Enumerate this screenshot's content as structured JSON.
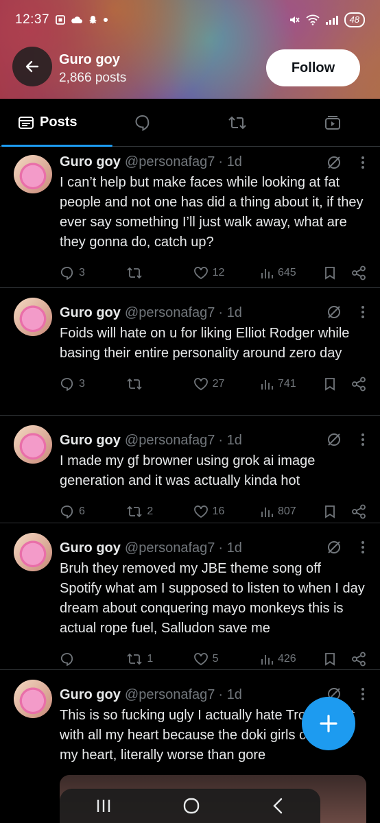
{
  "status_bar": {
    "time": "12:37",
    "battery": "48"
  },
  "header": {
    "name": "Guro goy",
    "posts_count": "2,866 posts",
    "follow_label": "Follow"
  },
  "tabs": [
    {
      "label": "Posts"
    }
  ],
  "posts": [
    {
      "name": "Guro goy",
      "handle": "@personafag7",
      "time": "· 1d",
      "text": "I can’t help but make faces while looking at fat people and not one has did a thing about it, if they ever say something I’ll just walk away, what are they gonna do, catch up?",
      "replies": "3",
      "reposts": "",
      "likes": "12",
      "views": "645"
    },
    {
      "name": "Guro goy",
      "handle": "@personafag7",
      "time": "· 1d",
      "text": "Foids will hate on u for liking Elliot Rodger while basing their entire personality around zero day",
      "replies": "3",
      "reposts": "",
      "likes": "27",
      "views": "741"
    },
    {
      "name": "Guro goy",
      "handle": "@personafag7",
      "time": "· 1d",
      "text": "I made my gf browner using grok ai image generation and it was actually kinda hot",
      "replies": "6",
      "reposts": "2",
      "likes": "16",
      "views": "807"
    },
    {
      "name": "Guro goy",
      "handle": "@personafag7",
      "time": "· 1d",
      "text": "Bruh they removed my JBE theme song off Spotify what am I supposed to listen to when I day dream about conquering mayo monkeys this is actual rope fuel, Salludon save me",
      "replies": "",
      "reposts": "1",
      "likes": "5",
      "views": "426"
    },
    {
      "name": "Guro goy",
      "handle": "@personafag7",
      "time": "· 1d",
      "text": "This is so fucking ugly I actually hate Troon artist with all my heart because the doki girls close to my heart, literally worse than gore",
      "replies": "",
      "reposts": "",
      "likes": "",
      "views": ""
    }
  ],
  "colors": {
    "accent": "#1d9bf0",
    "muted": "#71767b",
    "background": "#000000"
  }
}
